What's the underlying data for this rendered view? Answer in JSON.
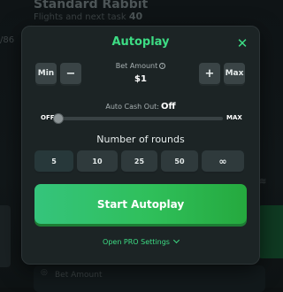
{
  "background": {
    "title": "Standard Rabbit",
    "subtitle": "Flights and next task",
    "subtitle_count": "40",
    "left_edge_text": "/86",
    "bet_label": "Bet Amount"
  },
  "modal": {
    "title": "Autoplay",
    "close_icon": "close-icon",
    "bet": {
      "label": "Bet Amount",
      "value": "$1",
      "min_label": "Min",
      "minus_label": "−",
      "plus_label": "+",
      "max_label": "Max"
    },
    "auto_cash_out": {
      "label": "Auto Cash Out:",
      "value": "Off",
      "min_label": "OFF",
      "max_label": "MAX",
      "level": 0
    },
    "rounds": {
      "label": "Number of rounds",
      "options": [
        "5",
        "10",
        "25",
        "50",
        "∞"
      ]
    },
    "start_label": "Start Autoplay",
    "pro_settings_label": "Open PRO Settings"
  },
  "colors": {
    "accent": "#3ddc84",
    "start_button": "#2fbf5a",
    "modal_bg": "#1c2425"
  }
}
